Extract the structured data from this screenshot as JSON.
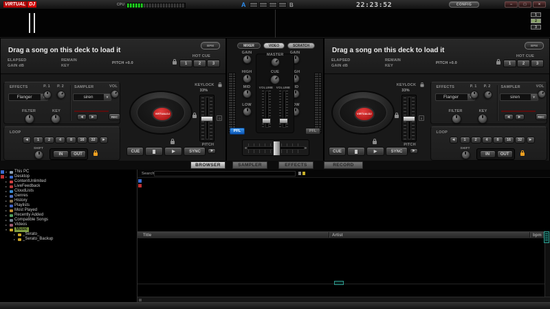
{
  "titlebar": {
    "logo_virtual": "VIRTUAL",
    "logo_dj": "DJ",
    "cpu_label": "CPU",
    "deck_a_indicator": "A",
    "deck_b_indicator": "B",
    "clock": "22:23:52",
    "config_label": "CONFIG",
    "minimize": "−",
    "maximize": "□",
    "close": "×"
  },
  "waveform": {
    "zoom_buttons": [
      "1",
      "2",
      "3"
    ],
    "active_zoom": "2"
  },
  "deck_labels": {
    "drop_text": "Drag a song on this deck to load it",
    "bpm_badge": "BPM",
    "elapsed": "ELAPSED",
    "remain": "REMAIN",
    "gain_db": "GAIN dB",
    "key": "KEY",
    "hot_cue": "HOT CUE",
    "hotcues": [
      "1",
      "2",
      "3"
    ],
    "effects": "EFFECTS",
    "p1": "P. 1",
    "p2": "P. 2",
    "filter": "FILTER",
    "key_knob": "KEY",
    "sampler": "SAMPLER",
    "vol": "VOL",
    "rec": "REC",
    "loop": "LOOP",
    "loop_lengths": [
      "1",
      "2",
      "4",
      "8",
      "16",
      "32"
    ],
    "shift": "SHIFT",
    "loop_in": "IN",
    "loop_out": "OUT",
    "keylock": "KEYLOCK",
    "pitch": "PITCH",
    "cue": "CUE",
    "sync": "SYNC",
    "play": "▶",
    "arrow_left": "◄",
    "arrow_right": "►",
    "dropdown_arrow": "▼",
    "zero": "0",
    "brand": "VIRTUALDJ"
  },
  "decks": {
    "a": {
      "pitch_display": "PITCH +0.0",
      "keylock_value": "33%",
      "effect": "Flanger",
      "sample": "siren"
    },
    "b": {
      "pitch_display": "PITCH +0.0",
      "keylock_value": "33%",
      "effect": "Flanger",
      "sample": "siren"
    }
  },
  "mixer": {
    "tabs": [
      "MIXER",
      "VIDEO",
      "SCRATCH"
    ],
    "gain": "GAIN",
    "high": "HIGH",
    "mid": "MID",
    "low": "LOW",
    "master": "MASTER",
    "cue": "CUE",
    "volume": "VOLUME",
    "pfl": "PFL"
  },
  "browser": {
    "tabs": [
      "BROWSER",
      "SAMPLER",
      "EFFECTS",
      "RECORD"
    ],
    "active_tab": "BROWSER",
    "search_label": "Search:",
    "columns": {
      "title": "Title",
      "artist": "Artist",
      "bpm": "bpm"
    },
    "tree": [
      "This PC",
      "Desktop",
      "ContentUnlimited",
      "LiveFeedback",
      "CloudLists",
      "Genres",
      "History",
      "Playlists",
      "Most Played",
      "Recently Added",
      "Compatible Songs",
      "Videos",
      "Music",
      "_Serato_",
      "_Serato_Backup"
    ],
    "selected_item": "Music",
    "expand_open": "▾",
    "expand_closed": "▸"
  },
  "colors": {
    "accent_blue": "#1779d8",
    "meter_green": "#1fd41f",
    "selected_green": "#7d9c3f",
    "lock_orange": "#f0a020",
    "logo_red": "#c40000",
    "teal": "#2f9c8f"
  }
}
